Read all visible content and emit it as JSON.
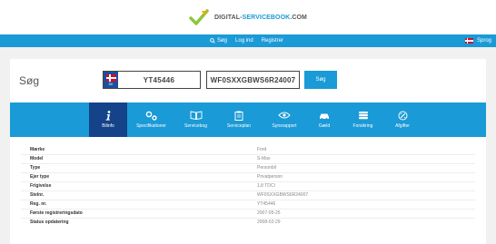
{
  "logo": {
    "part1": "DIGITAL-",
    "part2": "SERVICEBOOK",
    "part3": ".COM"
  },
  "topnav": {
    "search": "Søg",
    "login": "Log ind",
    "register": "Registrer",
    "language": "Sprog"
  },
  "search": {
    "title": "Søg",
    "country_code": "DK",
    "plate": "YT45446",
    "vin": "WF0SXXGBWS6R24007",
    "button": "Søg"
  },
  "tabs": [
    {
      "label": "Bilinfo",
      "icon": "info-icon",
      "active": true
    },
    {
      "label": "Specifikationer",
      "icon": "gears-icon",
      "active": false
    },
    {
      "label": "Servicebog",
      "icon": "book-icon",
      "active": false
    },
    {
      "label": "Serviceplan",
      "icon": "clipboard-icon",
      "active": false
    },
    {
      "label": "Synsrapport",
      "icon": "eye-icon",
      "active": false
    },
    {
      "label": "Gæld",
      "icon": "car-icon",
      "active": false
    },
    {
      "label": "Forsikring",
      "icon": "stack-icon",
      "active": false
    },
    {
      "label": "Afgifter",
      "icon": "tax-icon",
      "active": false
    }
  ],
  "details": [
    {
      "label": "Mærke",
      "value": "Ford"
    },
    {
      "label": "Model",
      "value": "S-Max"
    },
    {
      "label": "Type",
      "value": "Personbil"
    },
    {
      "label": "Ejer type",
      "value": "Privatperson"
    },
    {
      "label": "Frigivelse",
      "value": "1,8 TDCI"
    },
    {
      "label": "Stelnr.",
      "value": "WF0SXXGBWS6R24007"
    },
    {
      "label": "Reg. nr.",
      "value": "YT45446"
    },
    {
      "label": "Første registreringsdato",
      "value": "2007-05-25"
    },
    {
      "label": "Status opdatering",
      "value": "2008-02-29"
    }
  ],
  "colors": {
    "brand_blue": "#1a9ad6",
    "active_tab": "#14438a",
    "flag_red": "#c8102e"
  }
}
